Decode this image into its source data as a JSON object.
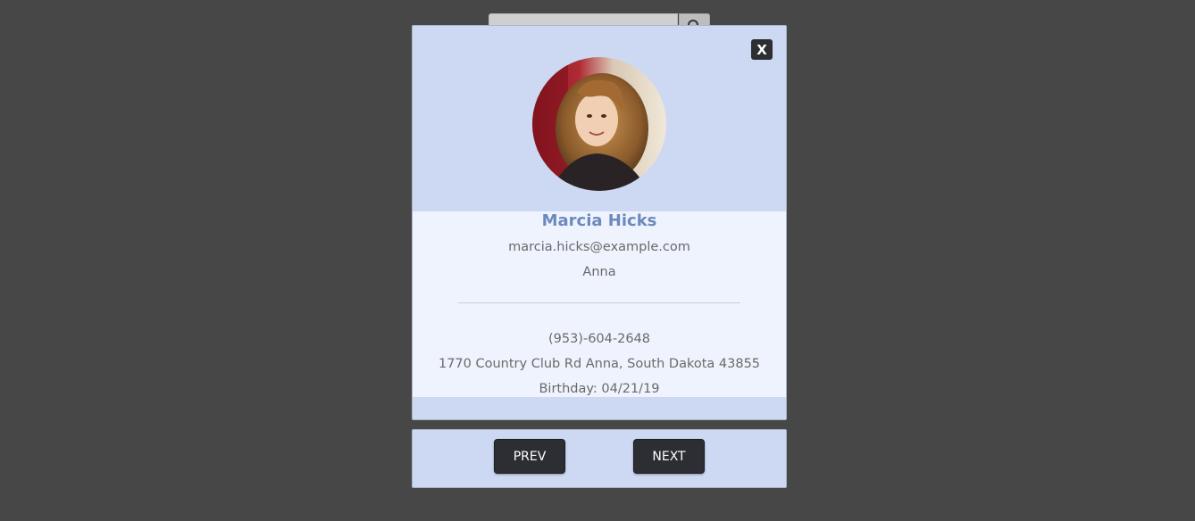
{
  "colors": {
    "overlay": "#474747",
    "modal_bg": "#cdd9f3",
    "info_bg": "#eff3fd",
    "name_color": "#6c8abd",
    "button_bg": "#2c2e33"
  },
  "background": {
    "search_button_icon": "search-icon"
  },
  "modal": {
    "close_label": "X",
    "avatar_alt": "avatar",
    "name": "Marcia Hicks",
    "email": "marcia.hicks@example.com",
    "city": "Anna",
    "phone": "(953)-604-2648",
    "address": "1770 Country Club Rd Anna, South Dakota 43855",
    "birthday": "Birthday: 04/21/19"
  },
  "nav": {
    "prev_label": "PREV",
    "next_label": "NEXT"
  }
}
